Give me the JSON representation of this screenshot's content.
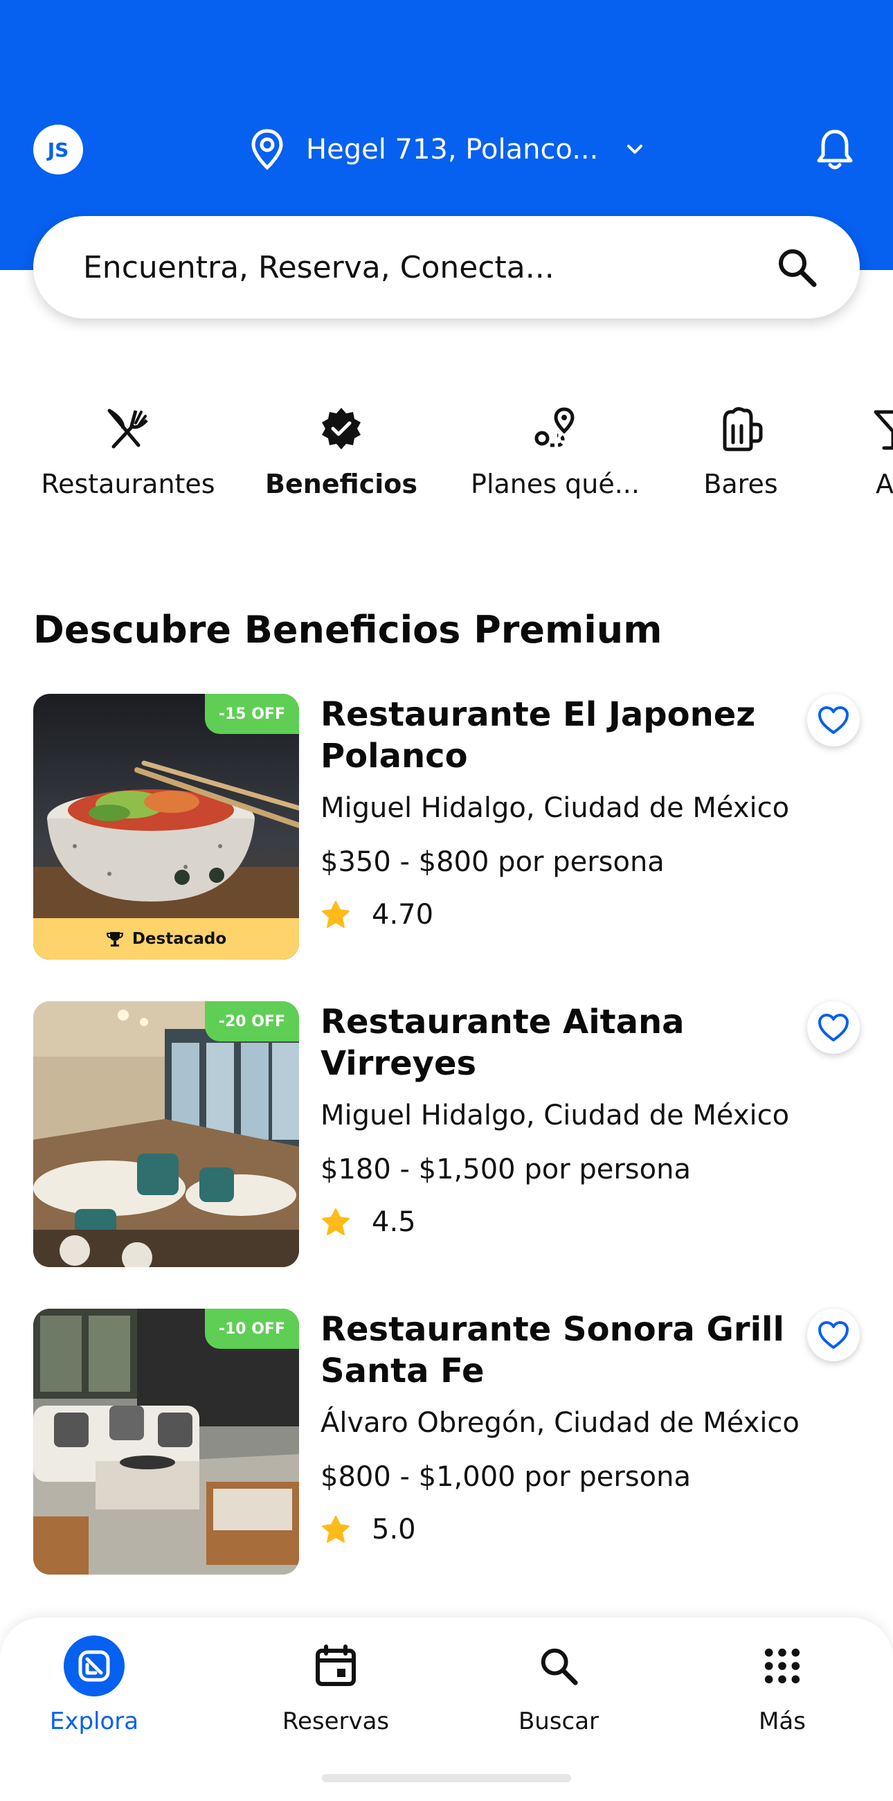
{
  "header": {
    "avatar_initials": "JS",
    "location": "Hegel 713, Polanco...",
    "accent_color": "#0660f0"
  },
  "search": {
    "placeholder": "Encuentra, Reserva, Conecta..."
  },
  "categories": [
    {
      "label": "Restaurantes",
      "icon": "fork-knife-icon"
    },
    {
      "label": "Beneficios",
      "icon": "badge-check-icon",
      "active": true
    },
    {
      "label": "Planes qué...",
      "icon": "route-pin-icon"
    },
    {
      "label": "Bares",
      "icon": "beer-mug-icon"
    },
    {
      "label": "An",
      "icon": "cocktail-icon"
    }
  ],
  "section": {
    "title": "Descubre Beneficios Premium"
  },
  "restaurants": [
    {
      "name": "Restaurante El Japonez Polanco",
      "location": "Miguel Hidalgo, Ciudad de México",
      "price": "$350 - $800 por persona",
      "rating": "4.70",
      "discount": "-15 OFF",
      "featured": "Destacado"
    },
    {
      "name": "Restaurante Aitana Virreyes",
      "location": "Miguel Hidalgo, Ciudad de México",
      "price": "$180 - $1,500 por persona",
      "rating": "4.5",
      "discount": "-20 OFF"
    },
    {
      "name": "Restaurante Sonora Grill Santa Fe",
      "location": "Álvaro Obregón, Ciudad de México",
      "price": "$800 - $1,000 por persona",
      "rating": "5.0",
      "discount": "-10 OFF"
    }
  ],
  "nav": [
    {
      "label": "Explora",
      "icon": "explore-icon",
      "active": true
    },
    {
      "label": "Reservas",
      "icon": "calendar-icon"
    },
    {
      "label": "Buscar",
      "icon": "search-icon"
    },
    {
      "label": "Más",
      "icon": "grid-dots-icon"
    }
  ]
}
